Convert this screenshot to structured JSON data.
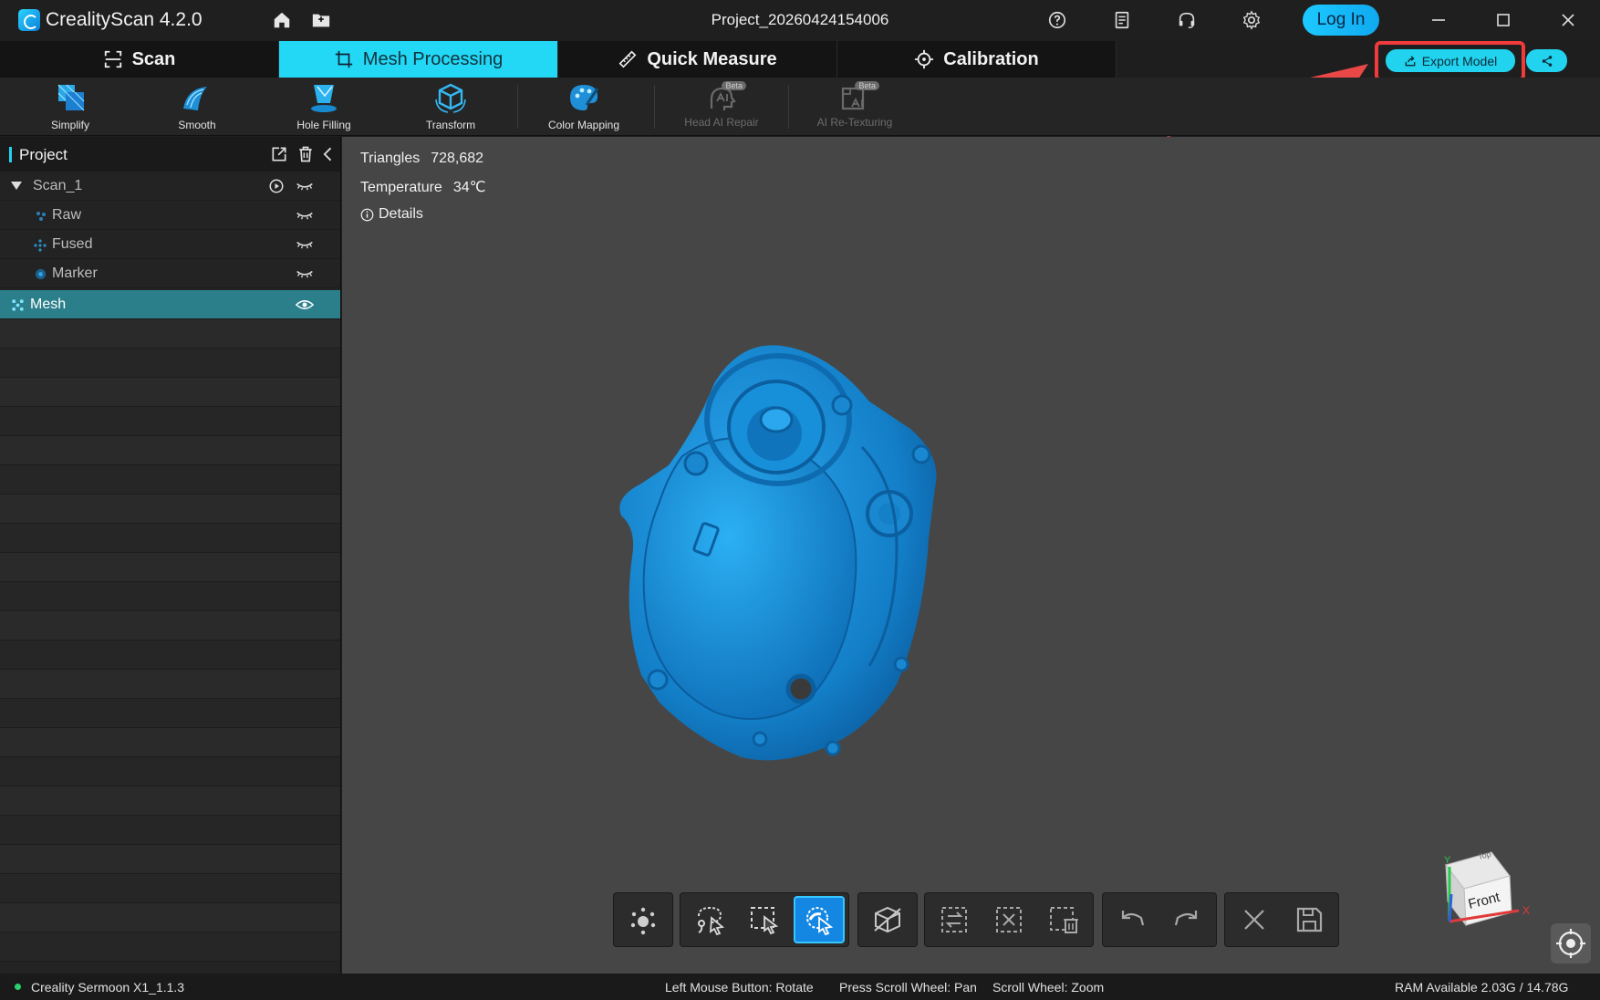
{
  "titlebar": {
    "app_title": "CrealityScan 4.2.0",
    "project_name": "Project_20260424154006",
    "login_label": "Log In"
  },
  "tabs": [
    {
      "label": "Scan",
      "icon": "scan-frame-icon"
    },
    {
      "label": "Mesh Processing",
      "icon": "crop-icon"
    },
    {
      "label": "Quick Measure",
      "icon": "ruler-icon"
    },
    {
      "label": "Calibration",
      "icon": "crosshair-icon"
    }
  ],
  "export": {
    "label": "Export Model"
  },
  "toolbar": {
    "simplify": "Simplify",
    "smooth": "Smooth",
    "hole_filling": "Hole Filling",
    "transform": "Transform",
    "color_mapping": "Color Mapping",
    "head_ai_repair": "Head AI Repair",
    "ai_retexturing": "AI Re-Texturing",
    "beta": "Beta"
  },
  "sidebar": {
    "title": "Project",
    "items": [
      {
        "label": "Scan_1"
      },
      {
        "label": "Raw"
      },
      {
        "label": "Fused"
      },
      {
        "label": "Marker"
      },
      {
        "label": "Mesh"
      }
    ]
  },
  "viewport": {
    "triangles_label": "Triangles",
    "triangles_value": "728,682",
    "temperature_label": "Temperature",
    "temperature_value": "34℃",
    "details_label": "Details",
    "viewcube_front": "Front",
    "viewcube_top": "Top",
    "axis_x": "X",
    "axis_y": "Y"
  },
  "statusbar": {
    "device": "Creality Sermoon X1_1.1.3",
    "hint_rotate": "Left Mouse Button: Rotate",
    "hint_pan": "Press Scroll Wheel: Pan",
    "hint_zoom": "Scroll Wheel: Zoom",
    "ram": "RAM Available 2.03G / 14.78G"
  },
  "colors": {
    "accent": "#22d8f5",
    "mesh": "#1b8fd6",
    "highlight": "#ef3b3b",
    "selected_row": "#2b7f8a"
  }
}
